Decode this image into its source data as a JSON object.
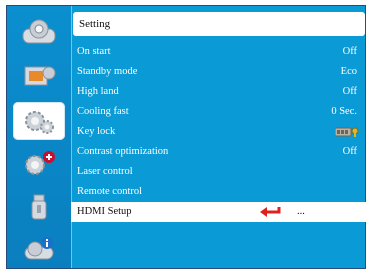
{
  "title": "Setting",
  "menu": [
    {
      "label": "On start",
      "value": "Off"
    },
    {
      "label": "Standby mode",
      "value": "Eco"
    },
    {
      "label": "High land",
      "value": "Off"
    },
    {
      "label": "Cooling fast",
      "value": "0 Sec."
    },
    {
      "label": "Key lock",
      "value": ""
    },
    {
      "label": "Contrast optimization",
      "value": "Off"
    },
    {
      "label": "Laser control",
      "value": ""
    },
    {
      "label": "Remote control",
      "value": ""
    },
    {
      "label": "HDMI Setup",
      "value": "..."
    }
  ],
  "sidebar": [
    "picture-settings-icon",
    "screen-icon",
    "settings-gears-icon",
    "expansion-gears-icon",
    "usb-icon",
    "info-icon"
  ],
  "colors": {
    "background": "#0a9bd6",
    "selected_row": "#ffffff",
    "arrow": "#e02020"
  }
}
